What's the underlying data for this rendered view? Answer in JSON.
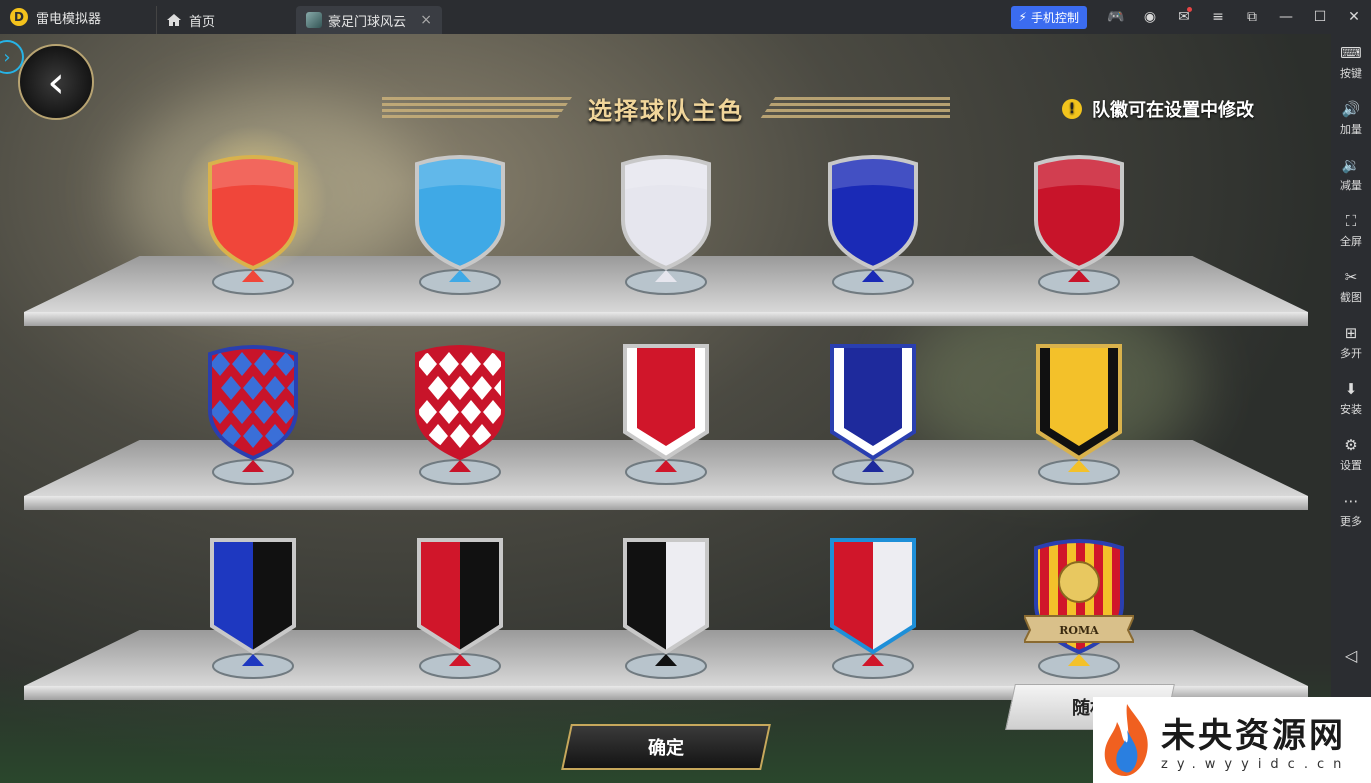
{
  "titlebar": {
    "app_name": "雷电模拟器",
    "home_tab": "首页",
    "game_tab": "豪足门球风云",
    "close_glyph": "×",
    "phone_control": "手机控制"
  },
  "game": {
    "title": "选择球队主色",
    "notice": "队徽可在设置中修改",
    "confirm_label": "确定",
    "random_label": "随机",
    "roma_banner": "ROMA",
    "shelves": [
      {
        "crests": [
          {
            "shape": "shield",
            "primary": "#f0463a",
            "secondary": "#f0463a",
            "rim": "#d9b24c",
            "selected": true
          },
          {
            "shape": "shield",
            "primary": "#3fa9e6",
            "secondary": "#3fa9e6",
            "rim": "#c8c8c8"
          },
          {
            "shape": "shield",
            "primary": "#e6e6ee",
            "secondary": "#e6e6ee",
            "rim": "#c8c8c8"
          },
          {
            "shape": "shield",
            "primary": "#1a2ab6",
            "secondary": "#1a2ab6",
            "rim": "#c8c8c8"
          },
          {
            "shape": "shield",
            "primary": "#c8142a",
            "secondary": "#c8142a",
            "rim": "#c8c8c8"
          }
        ]
      },
      {
        "crests": [
          {
            "shape": "diamond",
            "primary": "#c8142a",
            "secondary": "#3a6fd8",
            "rim": "#2a3fb0"
          },
          {
            "shape": "diamond",
            "primary": "#c8142a",
            "secondary": "#ffffff",
            "rim": "#c8142a"
          },
          {
            "shape": "pennant",
            "primary": "#d0162a",
            "secondary": "#ffffff",
            "rim": "#c8c8c8"
          },
          {
            "shape": "pennant",
            "primary": "#1e2a9c",
            "secondary": "#ffffff",
            "rim": "#2a3fb0"
          },
          {
            "shape": "pennant",
            "primary": "#f3c12a",
            "secondary": "#111111",
            "rim": "#d9b24c"
          }
        ]
      },
      {
        "crests": [
          {
            "shape": "split",
            "primary": "#1e38c0",
            "secondary": "#111111",
            "rim": "#c8c8c8"
          },
          {
            "shape": "split",
            "primary": "#d0162a",
            "secondary": "#111111",
            "rim": "#c8c8c8"
          },
          {
            "shape": "split",
            "primary": "#111111",
            "secondary": "#ededf2",
            "rim": "#c8c8c8"
          },
          {
            "shape": "split",
            "primary": "#d0162a",
            "secondary": "#ededf2",
            "rim": "#1e8fd8"
          },
          {
            "shape": "roma",
            "primary": "#f3c12a",
            "secondary": "#d0162a",
            "rim": "#2a3fb0"
          }
        ]
      }
    ]
  },
  "sidebar": {
    "items": [
      {
        "icon": "keyboard-icon",
        "glyph": "⌨",
        "label": "按键"
      },
      {
        "icon": "volume-up-icon",
        "glyph": "🔊",
        "label": "加量"
      },
      {
        "icon": "volume-down-icon",
        "glyph": "🔉",
        "label": "减量"
      },
      {
        "icon": "fullscreen-icon",
        "glyph": "⛶",
        "label": "全屏"
      },
      {
        "icon": "scissors-icon",
        "glyph": "✂",
        "label": "截图"
      },
      {
        "icon": "multi-window-icon",
        "glyph": "⊞",
        "label": "多开"
      },
      {
        "icon": "apk-icon",
        "glyph": "⬇",
        "label": "安装"
      },
      {
        "icon": "gear-icon",
        "glyph": "⚙",
        "label": "设置"
      },
      {
        "icon": "more-icon",
        "glyph": "⋯",
        "label": "更多"
      }
    ],
    "back_glyph": "◁"
  },
  "watermark": {
    "cn": "未央资源网",
    "en": "zy.wyyidc.cn"
  }
}
